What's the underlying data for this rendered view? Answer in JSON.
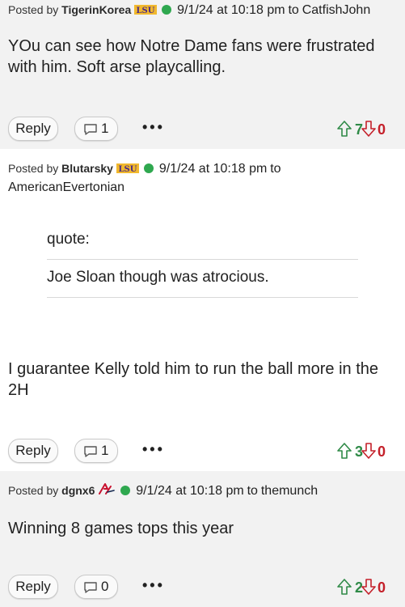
{
  "posts": [
    {
      "posted_by_label": "Posted by",
      "username": "TigerinKorea",
      "timestamp": "9/1/24 at 10:18 pm",
      "to_label": "to",
      "reply_to": "CatfishJohn",
      "body": "YOu can see how Notre Dame fans were frustrated with him. Soft arse playcalling.",
      "reply_label": "Reply",
      "comment_count": "1",
      "more_label": "•••",
      "upvotes": "7",
      "downvotes": "0",
      "badge": "LSU"
    },
    {
      "posted_by_label": "Posted by",
      "username": "Blutarsky",
      "timestamp": "9/1/24 at 10:18 pm",
      "to_label": "to",
      "reply_to": "AmericanEvertonian",
      "quote_label": "quote:",
      "quote_text": "Joe Sloan though was atrocious.",
      "body": "I guarantee Kelly told him to run the ball more in the 2H",
      "reply_label": "Reply",
      "comment_count": "1",
      "more_label": "•••",
      "upvotes": "3",
      "downvotes": "0",
      "badge": "LSU"
    },
    {
      "posted_by_label": "Posted by",
      "username": "dgnx6",
      "timestamp": "9/1/24 at 10:18 pm",
      "to_label": "to",
      "reply_to": "themunch",
      "body": "Winning 8 games tops this year",
      "reply_label": "Reply",
      "comment_count": "0",
      "more_label": "•••",
      "upvotes": "2",
      "downvotes": "0",
      "badge": "Braves"
    }
  ],
  "colors": {
    "online": "#2fa84f",
    "upvote": "#2f8a47",
    "downvote": "#c4202a",
    "post_bg": "#f2f2f2",
    "lsu_purple": "#4b2a84",
    "lsu_gold": "#f1b82d"
  }
}
